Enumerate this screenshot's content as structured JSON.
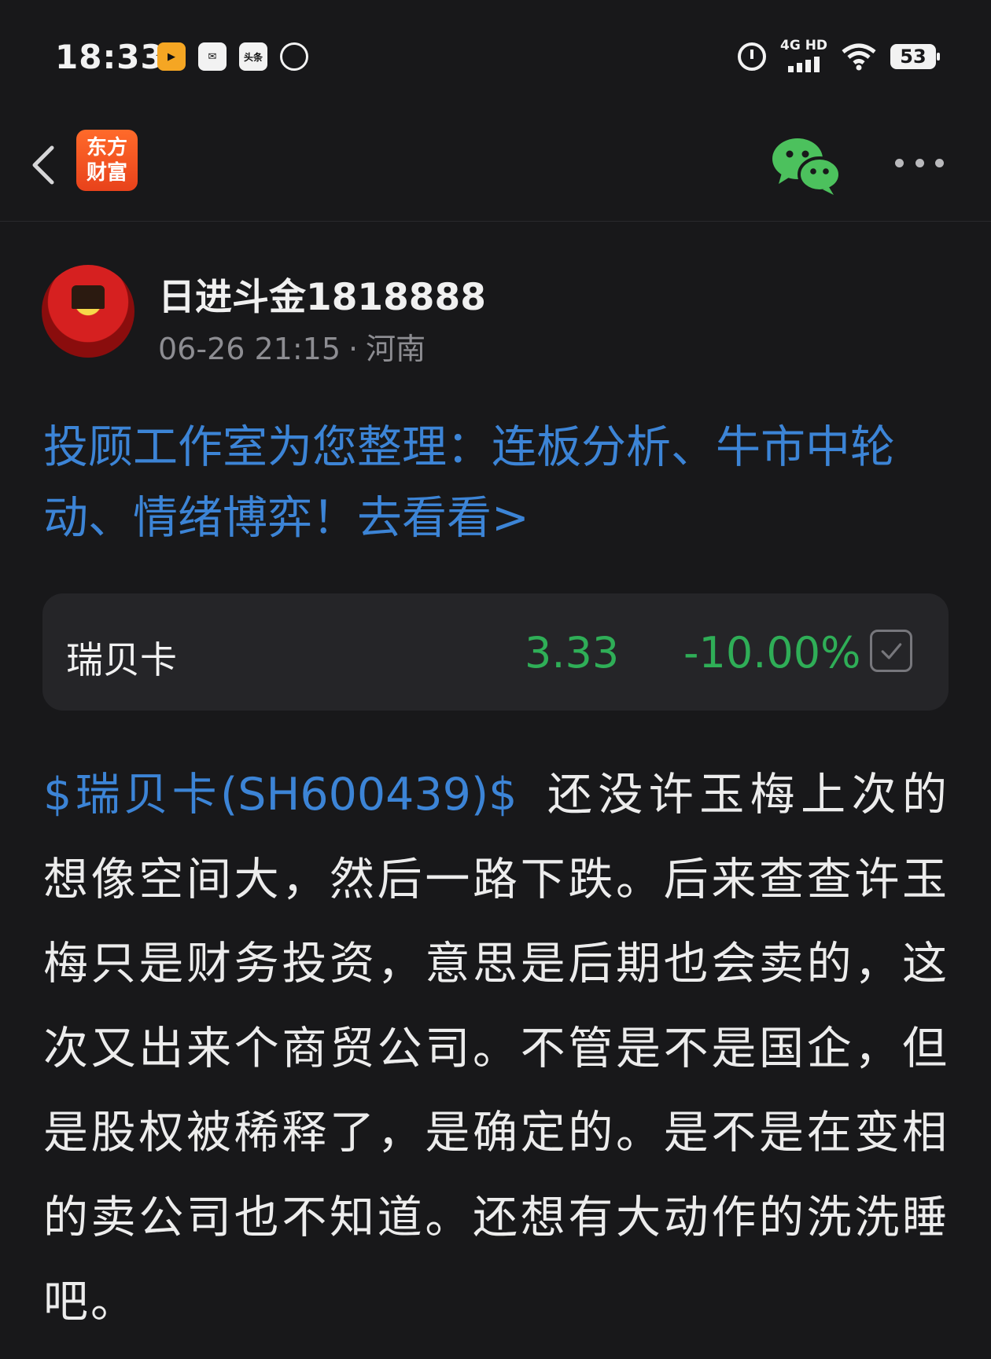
{
  "status_bar": {
    "time": "18:33",
    "app_icons": [
      "video-app-icon",
      "mail-app-icon",
      "toutiao-app-icon",
      "leaf-app-icon"
    ],
    "toutiao_label": "头条",
    "network": "4G HD",
    "battery": "53"
  },
  "nav": {
    "brand_line1": "东方",
    "brand_line2": "财富"
  },
  "author": {
    "name": "日进斗金1818888",
    "datetime": "06-26 21:15",
    "separator": "·",
    "location": "河南"
  },
  "promo": {
    "text": "投顾工作室为您整理：连板分析、牛市中轮动、情绪博弈！去看看>"
  },
  "stock_card": {
    "name": "瑞贝卡",
    "price": "3.33",
    "change": "-10.00%",
    "color_down": "#2fae57"
  },
  "post": {
    "stock_tag": "$瑞贝卡(SH600439)$",
    "text": "还没许玉梅上次的想像空间大，然后一路下跌。后来查查许玉梅只是财务投资，意思是后期也会卖的，这次又出来个商贸公司。不管是不是国企，但是股权被稀释了，是确定的。是不是在变相的卖公司也不知道。还想有大动作的洗洗睡吧。"
  },
  "colors": {
    "background": "#18181a",
    "link": "#3c84d6",
    "wechat": "#4cc15d",
    "brand": "#e8421b"
  }
}
